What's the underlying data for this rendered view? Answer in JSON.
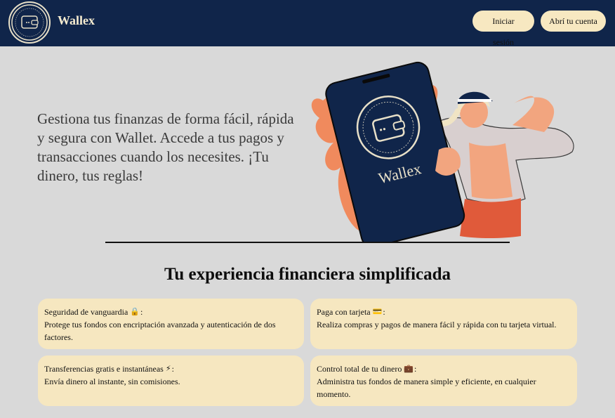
{
  "header": {
    "brand": "Wallex",
    "login_label": "Iniciar sesión",
    "signup_label": "Abrí tu cuenta"
  },
  "hero": {
    "text": "Gestiona tus finanzas de forma fácil, rápida y segura con Wallet. Accede a tus pagos y transacciones cuando los necesites. ¡Tu dinero, tus reglas!",
    "phone_brand": "Wallex"
  },
  "features": {
    "title": "Tu experiencia financiera simplificada",
    "cards": [
      {
        "title": "Seguridad de vanguardia",
        "icon": "lock-icon",
        "glyph": "🔒",
        "suffix": ":",
        "desc": "Protege tus fondos con encriptación avanzada y autenticación de dos factores."
      },
      {
        "title": "Paga con tarjeta",
        "icon": "credit-card-icon",
        "glyph": "💳",
        "suffix": ":",
        "desc": "Realiza compras y pagos de manera fácil y rápida con tu tarjeta virtual."
      },
      {
        "title": "Transferencias gratis e instantáneas",
        "icon": "lightning-icon",
        "glyph": "⚡",
        "suffix": ":",
        "desc": "Envía dinero al instante, sin comisiones."
      },
      {
        "title": "Control total de tu dinero",
        "icon": "briefcase-icon",
        "glyph": "💼",
        "suffix": ":",
        "desc": "Administra tus fondos de manera simple y eficiente, en cualquier momento."
      }
    ]
  },
  "colors": {
    "navbar": "#10254a",
    "background": "#d9d9d9",
    "accent": "#f6e7c0",
    "illustration_orange": "#f08a5d"
  }
}
